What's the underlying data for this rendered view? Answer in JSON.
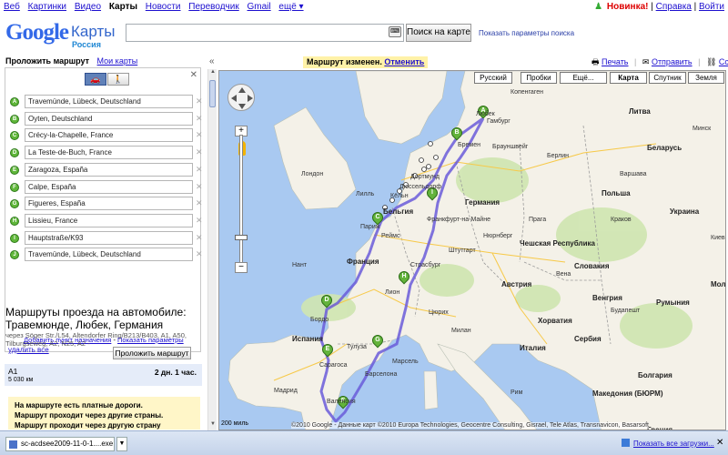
{
  "topnav": {
    "items": [
      "Веб",
      "Картинки",
      "Видео",
      "Карты",
      "Новости",
      "Переводчик",
      "Gmail",
      "ещё ▾"
    ],
    "new": "Новинка!",
    "help": "Справка",
    "signin": "Войти"
  },
  "header": {
    "logo_google": "Google",
    "logo_maps": "Карты",
    "logo_country": "Россия",
    "search_value": "",
    "search_button": "Поиск на карте",
    "search_options": "Показать параметры поиска",
    "banner_text": "Маршрут изменен.",
    "banner_undo": "Отменить"
  },
  "leftpanel": {
    "tab_route": "Проложить маршрут",
    "tab_mymaps": "Мои карты",
    "waypoints": [
      {
        "letter": "A",
        "value": "Travemünde, Lübeck, Deutschland"
      },
      {
        "letter": "B",
        "value": "Oyten, Deutschland"
      },
      {
        "letter": "C",
        "value": "Crécy-la-Chapelle, France"
      },
      {
        "letter": "D",
        "value": "La Teste-de-Buch, France"
      },
      {
        "letter": "E",
        "value": "Zaragoza, España"
      },
      {
        "letter": "F",
        "value": "Calpe, España"
      },
      {
        "letter": "G",
        "value": "Figueres, España"
      },
      {
        "letter": "H",
        "value": "Lissieu, France"
      },
      {
        "letter": "I",
        "value": "Hauptstraße/K93"
      },
      {
        "letter": "J",
        "value": "Travemünde, Lübeck, Deutschland"
      }
    ],
    "add_destination": "Добавить пункт назначения",
    "show_params": "Показать параметры",
    "route_button": "Проложить маршрут",
    "route_title": "Маршруты проезда на автомобиле: Травемюнде, Любек, Германия",
    "via": "через Söger Str./L54, Altendorfer Ring/B213/B403, A1, A50, Tilburgseweg, A2, N25, A2 -",
    "remove_all": "удалить все",
    "summary_road": "A1",
    "summary_km": "5 030 км",
    "summary_time": "2 дн. 1 час.",
    "warnings": [
      "На маршруте есть платные дороги.",
      "Маршрут проходит через другие страны.",
      "Маршрут проходит через другую страну"
    ]
  },
  "maplinks": {
    "print": "Печать",
    "send": "Отправить",
    "link": "Ссылка"
  },
  "mapbuttons": {
    "russian": "Русский",
    "traffic": "Пробки",
    "more": "Ещё...",
    "map": "Карта",
    "satellite": "Спутник",
    "terrain": "Земля"
  },
  "map": {
    "cities": [
      {
        "name": "Гамбург"
      },
      {
        "name": "Бремен"
      },
      {
        "name": "Брауншвейг"
      },
      {
        "name": "Дортмунд"
      },
      {
        "name": "Кёльн"
      },
      {
        "name": "Дюссельдорф"
      },
      {
        "name": "Лондон"
      },
      {
        "name": "Лилль"
      },
      {
        "name": "Париж"
      },
      {
        "name": "Реймс"
      },
      {
        "name": "Страсбург"
      },
      {
        "name": "Штутгарт"
      },
      {
        "name": "Франкфурт-на-Майне"
      },
      {
        "name": "Нюрнберг"
      },
      {
        "name": "Цюрих"
      },
      {
        "name": "Лион"
      },
      {
        "name": "Бордо"
      },
      {
        "name": "Тулуза"
      },
      {
        "name": "Марсель"
      },
      {
        "name": "Барселона"
      },
      {
        "name": "Сарагоса"
      },
      {
        "name": "Валенсия"
      },
      {
        "name": "Мадрид"
      },
      {
        "name": "Милан"
      },
      {
        "name": "Рим"
      },
      {
        "name": "Вена"
      },
      {
        "name": "Прага"
      },
      {
        "name": "Берлин"
      },
      {
        "name": "Варшава"
      },
      {
        "name": "Краков"
      },
      {
        "name": "Будапешт"
      },
      {
        "name": "Минск"
      },
      {
        "name": "Киев"
      },
      {
        "name": "Копенгаген"
      },
      {
        "name": "Нант"
      },
      {
        "name": "Любек"
      }
    ],
    "countries": [
      {
        "name": "Германия"
      },
      {
        "name": "Франция"
      },
      {
        "name": "Польша"
      },
      {
        "name": "Чешская Республика"
      },
      {
        "name": "Италия"
      },
      {
        "name": "Украина"
      },
      {
        "name": "Беларусь"
      },
      {
        "name": "Венгрия"
      },
      {
        "name": "Румыния"
      },
      {
        "name": "Сербия"
      },
      {
        "name": "Болгария"
      },
      {
        "name": "Испания"
      },
      {
        "name": "Австрия"
      },
      {
        "name": "Бельгия"
      },
      {
        "name": "Литва"
      },
      {
        "name": "Словакия"
      },
      {
        "name": "Хорватия"
      },
      {
        "name": "Греция"
      },
      {
        "name": "Македония (БЮРМ)"
      },
      {
        "name": "Молдова"
      }
    ],
    "scale": "200 миль",
    "copyright": "©2010 Google - Данные карт ©2010 Europa Technologies, Geocentre Consulting, Gisrael, Tele Atlas, Transnavicon, Basarsoft"
  },
  "taskbar": {
    "download_name": "sc-acdsee2009-11-0-1....exe",
    "show_all": "Показать все загрузки...",
    "close": "✕"
  },
  "colors": {
    "route": "#6a5cd9",
    "marker": "#5fb639",
    "water": "#a9c9f1",
    "land": "#f4f1e8"
  }
}
